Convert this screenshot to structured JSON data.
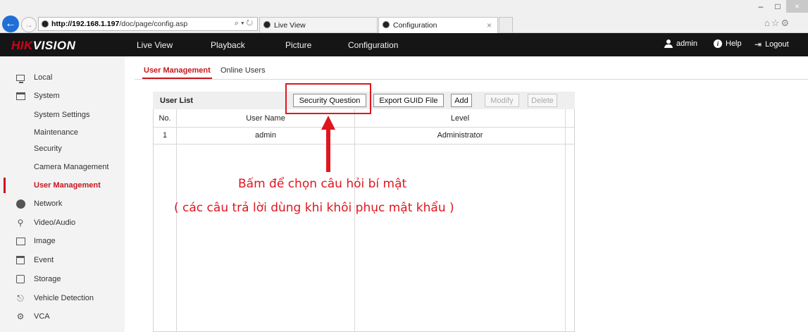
{
  "browser": {
    "url_host": "http://192.168.1.197",
    "url_path": "/doc/page/config.asp",
    "address_tools": "⌕ ▾ ↻",
    "tabs": [
      {
        "title": "Live View"
      },
      {
        "title": "Configuration",
        "close": "×"
      }
    ],
    "window_controls": {
      "minimize": "–",
      "maximize": "□",
      "close": "×"
    },
    "right_icons": "⌂☆⚙"
  },
  "app": {
    "logo_red": "HIK",
    "logo_white": "VISION",
    "nav": [
      "Live View",
      "Playback",
      "Picture",
      "Configuration"
    ],
    "user": "admin",
    "help": "Help",
    "logout": "Logout",
    "logout_icon": "⇥"
  },
  "sidebar": {
    "items": [
      {
        "label": "Local",
        "icon": "monitor-icon"
      },
      {
        "label": "System",
        "icon": "window-icon"
      },
      {
        "label": "System Settings",
        "child": true
      },
      {
        "label": "Maintenance",
        "child": true
      },
      {
        "label": "Security",
        "child": true
      },
      {
        "label": "Camera Management",
        "child": true
      },
      {
        "label": "User Management",
        "child": true,
        "selected": true
      },
      {
        "label": "Network",
        "icon": "globe-icon"
      },
      {
        "label": "Video/Audio",
        "icon": "mic-camera-icon"
      },
      {
        "label": "Image",
        "icon": "image-icon"
      },
      {
        "label": "Event",
        "icon": "calendar-icon"
      },
      {
        "label": "Storage",
        "icon": "disk-icon"
      },
      {
        "label": "Vehicle Detection",
        "icon": "car-search-icon"
      },
      {
        "label": "VCA",
        "icon": "vca-icon"
      }
    ]
  },
  "content": {
    "subtabs": [
      "User Management",
      "Online Users"
    ],
    "panel_title": "User List",
    "buttons": {
      "security_question": "Security Question",
      "export_guid": "Export GUID File",
      "add": "Add",
      "modify": "Modify",
      "delete": "Delete"
    },
    "table": {
      "headers": [
        "No.",
        "User Name",
        "Level"
      ],
      "rows": [
        {
          "no": "1",
          "name": "admin",
          "level": "Administrator"
        }
      ]
    }
  },
  "annotation": {
    "line1": "Bấm để chọn câu hỏi bí mật",
    "line2": "( các câu trả lời dùng khi  khôi phục mật khẩu )",
    "color": "#e0161f"
  },
  "colors": {
    "accent": "#c8161d",
    "header_bg": "#151515",
    "sidebar_bg": "#f3f3f3"
  }
}
